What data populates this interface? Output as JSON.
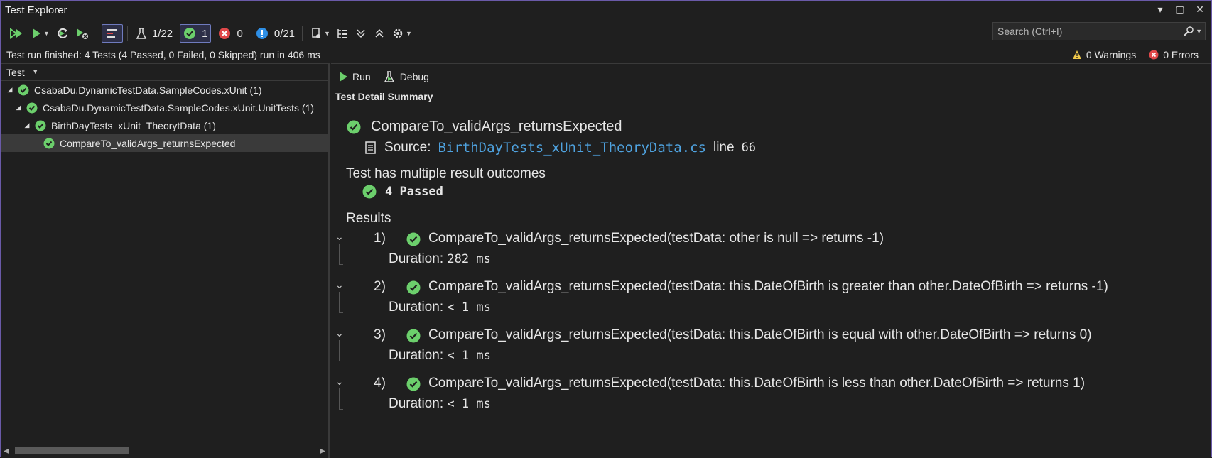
{
  "window": {
    "title": "Test Explorer"
  },
  "toolbar": {
    "tests_count": "1/22",
    "passed_count": "1",
    "failed_count": "0",
    "info_count": "0/21",
    "search_placeholder": "Search (Ctrl+I)"
  },
  "status": {
    "message": "Test run finished: 4 Tests (4 Passed, 0 Failed, 0 Skipped) run in 406 ms",
    "warnings": "0 Warnings",
    "errors": "0 Errors"
  },
  "tree": {
    "header": "Test",
    "rows": [
      {
        "label": "CsabaDu.DynamicTestData.SampleCodes.xUnit  (1)"
      },
      {
        "label": "CsabaDu.DynamicTestData.SampleCodes.xUnit.UnitTests  (1)"
      },
      {
        "label": "BirthDayTests_xUnit_TheorytData  (1)"
      },
      {
        "label": "CompareTo_validArgs_returnsExpected"
      }
    ]
  },
  "detail": {
    "run_label": "Run",
    "debug_label": "Debug",
    "summary_title": "Test Detail Summary",
    "test_name": "CompareTo_validArgs_returnsExpected",
    "source_label": "Source:",
    "source_file": "BirthDayTests_xUnit_TheoryData.cs",
    "line_label": "line",
    "line_number": "66",
    "multiple_outcomes": "Test has multiple result outcomes",
    "passed_summary": "4 Passed",
    "results_label": "Results",
    "duration_label": "Duration:",
    "results": [
      {
        "num": "1)",
        "name": "CompareTo_validArgs_returnsExpected(testData: other is null => returns -1)",
        "duration": "282 ms"
      },
      {
        "num": "2)",
        "name": "CompareTo_validArgs_returnsExpected(testData: this.DateOfBirth is greater than other.DateOfBirth => returns -1)",
        "duration": "< 1 ms"
      },
      {
        "num": "3)",
        "name": "CompareTo_validArgs_returnsExpected(testData: this.DateOfBirth is equal with other.DateOfBirth => returns 0)",
        "duration": "< 1 ms"
      },
      {
        "num": "4)",
        "name": "CompareTo_validArgs_returnsExpected(testData: this.DateOfBirth is less than other.DateOfBirth => returns 1)",
        "duration": "< 1 ms"
      }
    ]
  },
  "colors": {
    "pass_green": "#6ccf6c",
    "fail_red": "#e0484a",
    "info_blue": "#2e8fe6",
    "link_blue": "#4fa3e0",
    "accent_border": "#6a5aa8"
  }
}
